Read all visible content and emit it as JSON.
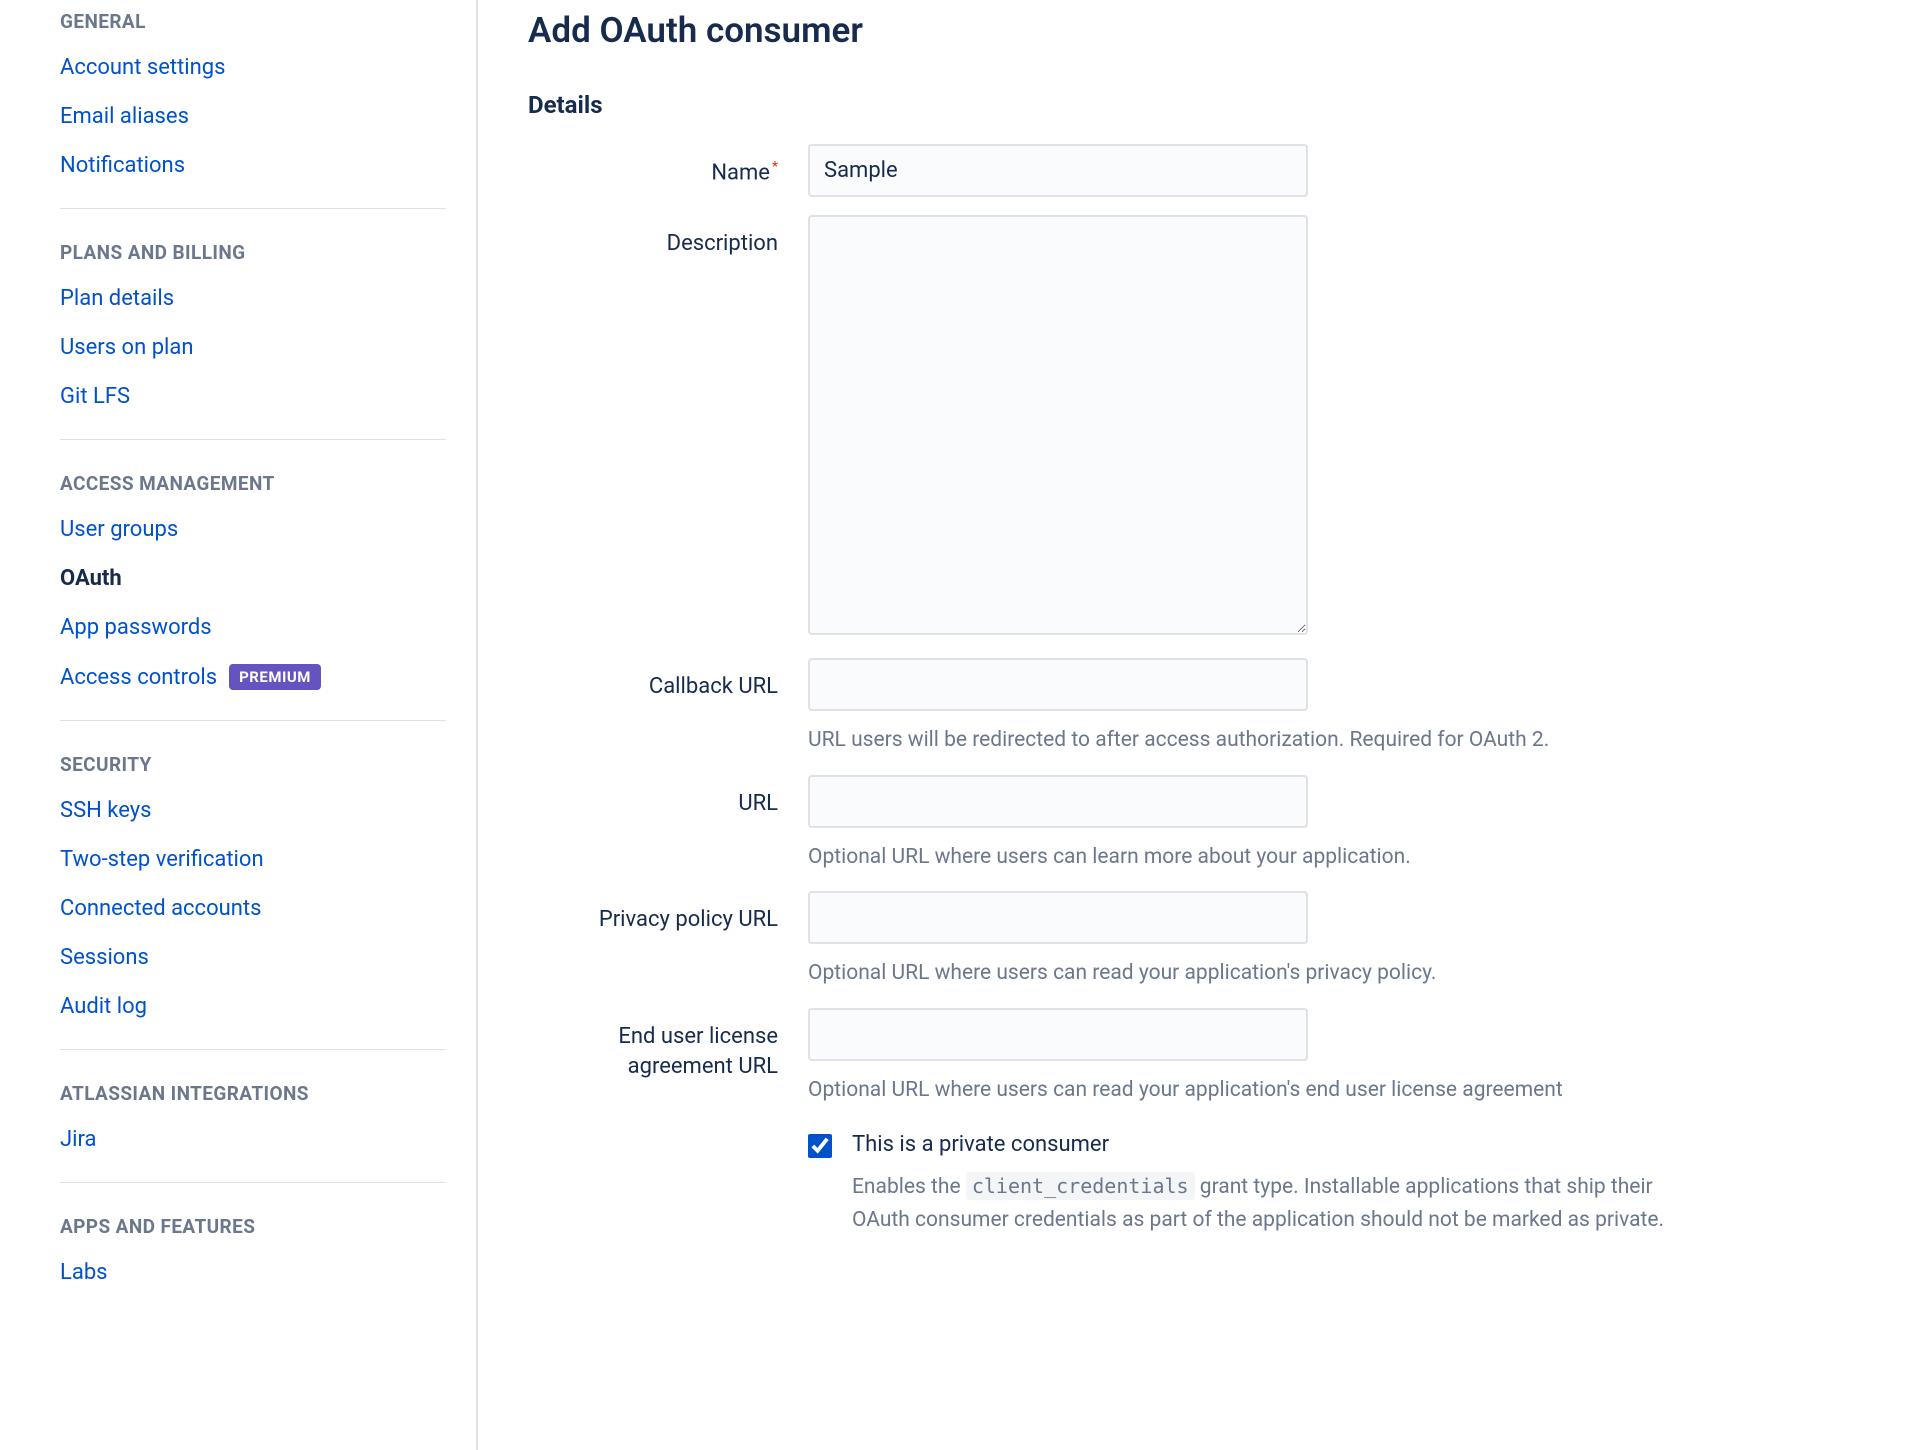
{
  "sidebar": {
    "sections": [
      {
        "header": "GENERAL",
        "items": [
          {
            "label": "Account settings",
            "name": "account-settings"
          },
          {
            "label": "Email aliases",
            "name": "email-aliases"
          },
          {
            "label": "Notifications",
            "name": "notifications"
          }
        ]
      },
      {
        "header": "PLANS AND BILLING",
        "items": [
          {
            "label": "Plan details",
            "name": "plan-details"
          },
          {
            "label": "Users on plan",
            "name": "users-on-plan"
          },
          {
            "label": "Git LFS",
            "name": "git-lfs"
          }
        ]
      },
      {
        "header": "ACCESS MANAGEMENT",
        "items": [
          {
            "label": "User groups",
            "name": "user-groups"
          },
          {
            "label": "OAuth",
            "name": "oauth",
            "active": true
          },
          {
            "label": "App passwords",
            "name": "app-passwords"
          },
          {
            "label": "Access controls",
            "name": "access-controls",
            "badge": "PREMIUM"
          }
        ]
      },
      {
        "header": "SECURITY",
        "items": [
          {
            "label": "SSH keys",
            "name": "ssh-keys"
          },
          {
            "label": "Two-step verification",
            "name": "two-step-verification"
          },
          {
            "label": "Connected accounts",
            "name": "connected-accounts"
          },
          {
            "label": "Sessions",
            "name": "sessions"
          },
          {
            "label": "Audit log",
            "name": "audit-log"
          }
        ]
      },
      {
        "header": "ATLASSIAN INTEGRATIONS",
        "items": [
          {
            "label": "Jira",
            "name": "jira"
          }
        ]
      },
      {
        "header": "APPS AND FEATURES",
        "items": [
          {
            "label": "Labs",
            "name": "labs"
          }
        ]
      }
    ]
  },
  "page": {
    "title": "Add OAuth consumer",
    "panel_title": "Details"
  },
  "form": {
    "name": {
      "label": "Name",
      "value": "Sample",
      "required": true
    },
    "description": {
      "label": "Description",
      "value": ""
    },
    "callback_url": {
      "label": "Callback URL",
      "value": "",
      "help": "URL users will be redirected to after access authorization. Required for OAuth 2."
    },
    "url": {
      "label": "URL",
      "value": "",
      "help": "Optional URL where users can learn more about your application."
    },
    "privacy_policy_url": {
      "label": "Privacy policy URL",
      "value": "",
      "help": "Optional URL where users can read your application's privacy policy."
    },
    "eula_url": {
      "label": "End user license agreement URL",
      "value": "",
      "help": "Optional URL where users can read your application's end user license agreement"
    },
    "private_consumer": {
      "checked": true,
      "label": "This is a private consumer",
      "help_pre": "Enables the ",
      "help_code": "client_credentials",
      "help_post": " grant type. Installable applications that ship their OAuth consumer credentials as part of the application should not be marked as private."
    }
  }
}
